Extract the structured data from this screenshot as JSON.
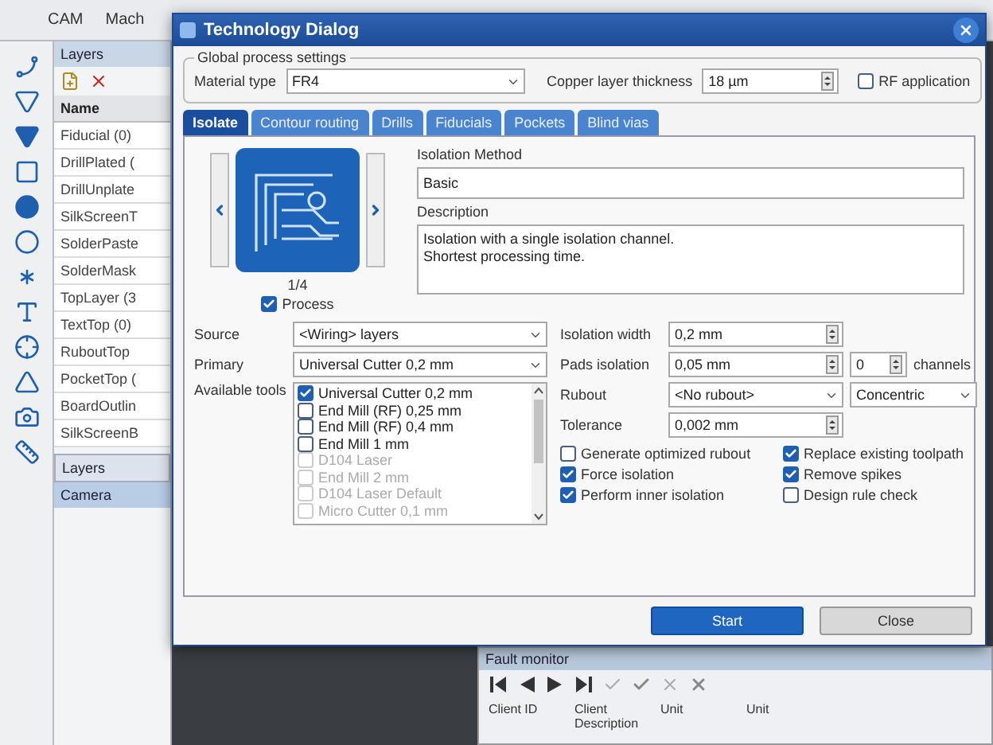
{
  "app": {
    "menu_items": [
      "CAM",
      "Mach"
    ]
  },
  "layers_panel": {
    "title": "Layers",
    "header": "Name",
    "layers": [
      "Fiducial (0)",
      "DrillPlated (",
      "DrillUnplate",
      "SilkScreenT",
      "SolderPaste",
      "SolderMask",
      "TopLayer (3",
      "TextTop (0)",
      "RuboutTop",
      "PocketTop (",
      "BoardOutlin",
      "SilkScreenB"
    ],
    "tab": "Layers",
    "camera_tab": "Camera"
  },
  "dialog": {
    "title": "Technology Dialog",
    "group_title": "Global process settings",
    "material_label": "Material type",
    "material": "FR4",
    "copper_label": "Copper layer thickness",
    "copper": "18 µm",
    "rf": {
      "label": "RF application",
      "checked": false
    },
    "tabs": [
      {
        "label": "Isolate",
        "selected": true
      },
      {
        "label": "Contour routing",
        "selected": false
      },
      {
        "label": "Drills",
        "selected": false
      },
      {
        "label": "Fiducials",
        "selected": false
      },
      {
        "label": "Pockets",
        "selected": false
      },
      {
        "label": "Blind vias",
        "selected": false
      }
    ],
    "preview": {
      "page": "1/4",
      "process": {
        "label": "Process",
        "checked": true
      }
    },
    "method_label": "Isolation Method",
    "method": "Basic",
    "description_label": "Description",
    "description": [
      "Isolation with a single isolation channel.",
      "Shortest processing time."
    ],
    "source_label": "Source",
    "source": "<Wiring> layers",
    "primary_label": "Primary",
    "primary": "Universal Cutter 0,2 mm",
    "tools_label": "Available tools",
    "tools": [
      {
        "name": "Universal Cutter 0,2 mm",
        "checked": true,
        "disabled": false
      },
      {
        "name": "End Mill (RF) 0,25 mm",
        "checked": false,
        "disabled": false
      },
      {
        "name": "End Mill (RF) 0,4 mm",
        "checked": false,
        "disabled": false
      },
      {
        "name": "End Mill 1 mm",
        "checked": false,
        "disabled": false
      },
      {
        "name": "D104 Laser",
        "checked": false,
        "disabled": true
      },
      {
        "name": "End Mill 2 mm",
        "checked": false,
        "disabled": true
      },
      {
        "name": "D104 Laser Default",
        "checked": false,
        "disabled": true
      },
      {
        "name": "Micro Cutter 0,1 mm",
        "checked": false,
        "disabled": true
      }
    ],
    "params": [
      {
        "label": "Isolation width",
        "value": "0,2 mm",
        "kind": "spin"
      },
      {
        "label": "Pads isolation",
        "value": "0,05 mm",
        "kind": "spin"
      },
      {
        "label": "Rubout",
        "value": "<No rubout>",
        "kind": "select"
      },
      {
        "label": "Tolerance",
        "value": "0,002 mm",
        "kind": "spin"
      }
    ],
    "channels": {
      "value": "0",
      "label": "channels"
    },
    "pattern": "Concentric",
    "options": [
      {
        "label": "Generate optimized rubout",
        "checked": false
      },
      {
        "label": "Force isolation",
        "checked": true
      },
      {
        "label": "Perform inner isolation",
        "checked": true
      },
      {
        "label": "Replace existing toolpath",
        "checked": true
      },
      {
        "label": "Remove spikes",
        "checked": true
      },
      {
        "label": "Design rule check",
        "checked": false
      }
    ],
    "buttons": [
      "Start",
      "Close"
    ]
  },
  "fault_monitor": {
    "title": "Fault monitor",
    "columns": [
      "Client ID",
      "Client Description",
      "Unit",
      "Unit"
    ]
  }
}
